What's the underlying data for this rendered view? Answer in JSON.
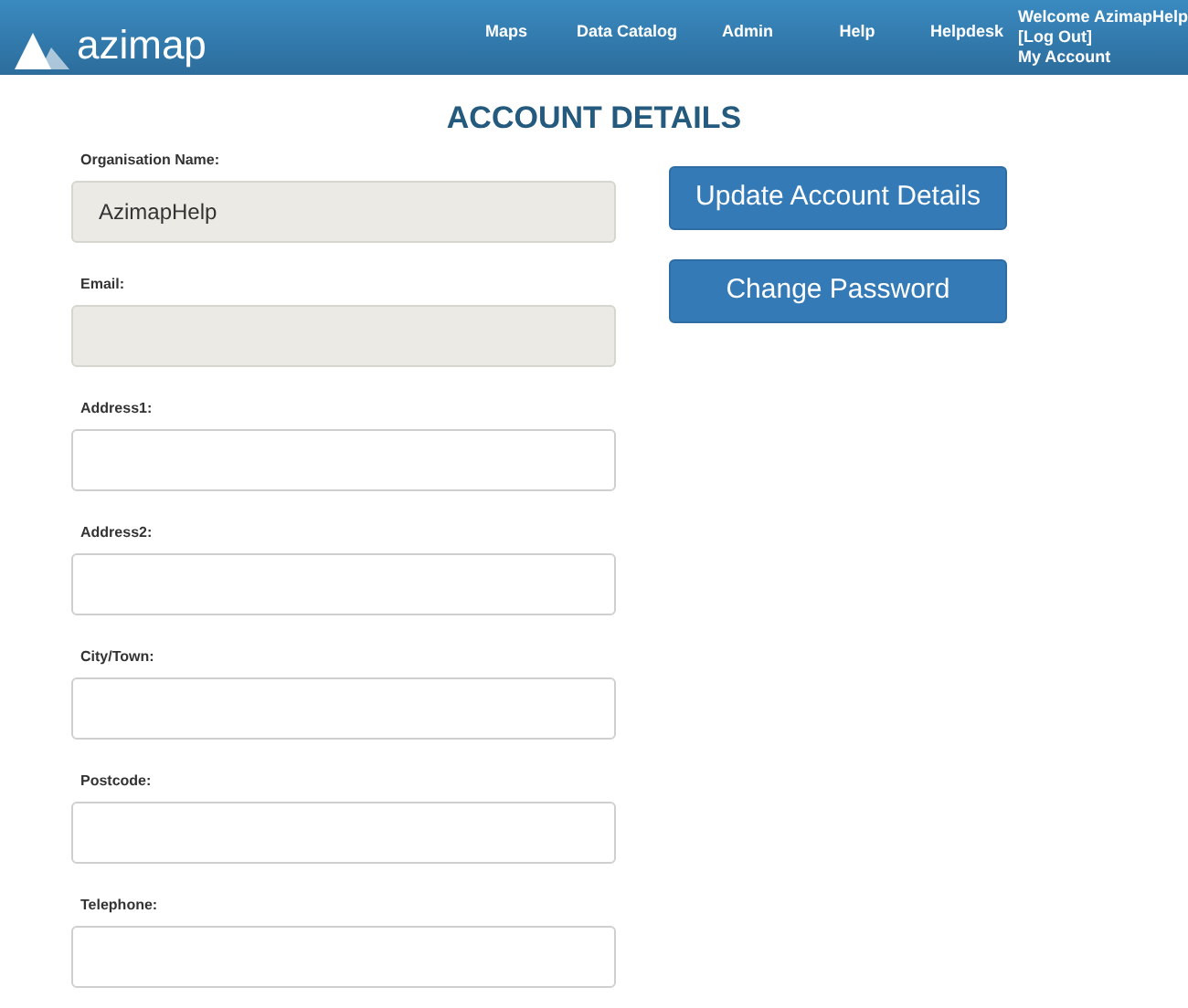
{
  "header": {
    "logo_text": "azimap",
    "nav": [
      "Maps",
      "Data Catalog",
      "Admin",
      "Help",
      "Helpdesk"
    ],
    "user": {
      "welcome": "Welcome AzimapHelp",
      "logout": "[Log Out]",
      "account": "My Account"
    }
  },
  "title": "ACCOUNT DETAILS",
  "fields": [
    {
      "label": "Organisation Name:",
      "value": "AzimapHelp",
      "disabled": true
    },
    {
      "label": "Email:",
      "disabled": true
    },
    {
      "label": "Address1:",
      "disabled": false
    },
    {
      "label": "Address2:",
      "disabled": false
    },
    {
      "label": "City/Town:",
      "disabled": false
    },
    {
      "label": "Postcode:",
      "disabled": false
    },
    {
      "label": "Telephone:",
      "disabled": false
    }
  ],
  "buttons": [
    "Update Account Details",
    "Change Password"
  ]
}
